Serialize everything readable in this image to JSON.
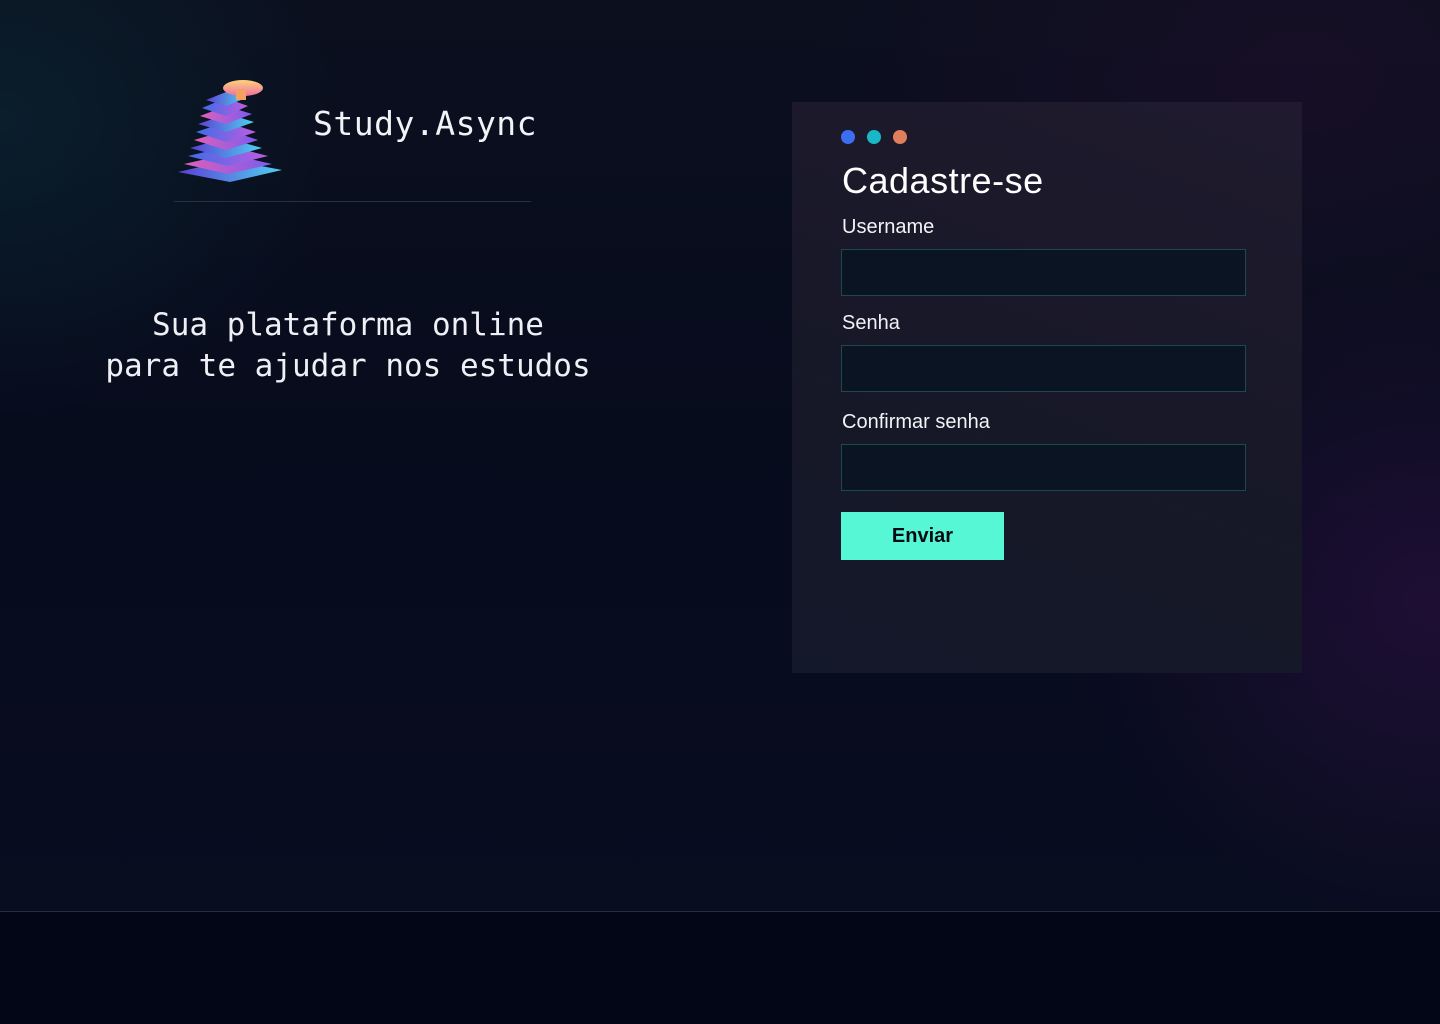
{
  "brand": {
    "name": "Study.Async",
    "logo_icon": "book-stack-icon"
  },
  "tagline": {
    "line1": "Sua plataforma online",
    "line2": "para te ajudar nos estudos"
  },
  "signup": {
    "window_dots": [
      "#3e6ef0",
      "#19b8c8",
      "#e07f5c"
    ],
    "title": "Cadastre-se",
    "fields": [
      {
        "label": "Username",
        "value": ""
      },
      {
        "label": "Senha",
        "value": ""
      },
      {
        "label": "Confirmar senha",
        "value": ""
      }
    ],
    "submit_label": "Enviar"
  },
  "colors": {
    "accent": "#55f7d4",
    "input_border": "#1c4a4c"
  }
}
